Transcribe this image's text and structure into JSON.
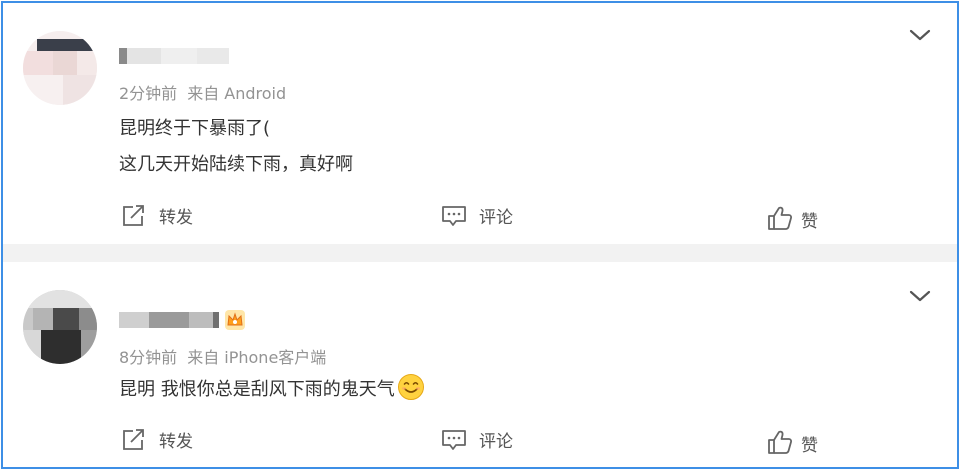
{
  "posts": [
    {
      "time": "2分钟前",
      "source": "来自 Android",
      "content_lines": [
        "昆明终于下暴雨了(",
        "这几天开始陆续下雨，真好啊"
      ],
      "actions": {
        "repost": "转发",
        "comment": "评论",
        "like": "赞"
      }
    },
    {
      "time": "8分钟前",
      "source": "来自 iPhone客户端",
      "content_lines": [
        "昆明 我恨你总是刮风下雨的鬼天气"
      ],
      "actions": {
        "repost": "转发",
        "comment": "评论",
        "like": "赞"
      }
    }
  ],
  "icons": {
    "expand": "chevron-down-icon",
    "repost": "repost-icon",
    "comment": "comment-icon",
    "like": "thumbs-up-icon",
    "crown": "crown-icon",
    "emoji": "smile-emoji-icon"
  },
  "colors": {
    "border": "#3d8fe6",
    "separator": "#f2f2f2",
    "meta_text": "#939393",
    "body_text": "#333333"
  }
}
